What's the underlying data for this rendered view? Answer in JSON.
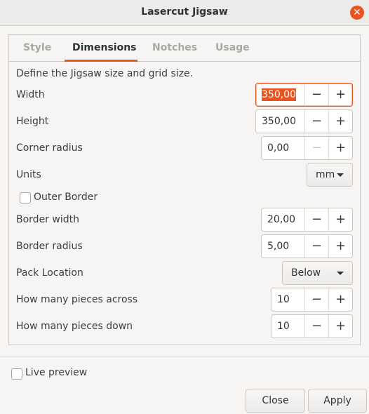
{
  "window": {
    "title": "Lasercut Jigsaw"
  },
  "tabs": [
    {
      "label": "Style",
      "active": false
    },
    {
      "label": "Dimensions",
      "active": true
    },
    {
      "label": "Notches",
      "active": false
    },
    {
      "label": "Usage",
      "active": false
    }
  ],
  "page": {
    "description": "Define the Jigsaw size and grid size.",
    "width": {
      "label": "Width",
      "value": "350,00"
    },
    "height": {
      "label": "Height",
      "value": "350,00"
    },
    "corner_radius": {
      "label": "Corner radius",
      "value": "0,00"
    },
    "units": {
      "label": "Units",
      "selected": "mm"
    },
    "outer_border": {
      "label": "Outer Border",
      "checked": false
    },
    "border_width": {
      "label": "Border width",
      "value": "20,00"
    },
    "border_radius": {
      "label": "Border radius",
      "value": "5,00"
    },
    "pack_location": {
      "label": "Pack Location",
      "selected": "Below"
    },
    "pieces_across": {
      "label": "How many pieces across",
      "value": "10"
    },
    "pieces_down": {
      "label": "How many pieces down",
      "value": "10"
    }
  },
  "spin": {
    "minus": "−",
    "plus": "+"
  },
  "footer": {
    "live_preview": {
      "label": "Live preview",
      "checked": false
    },
    "close_label": "Close",
    "apply_label": "Apply"
  },
  "icons": {
    "close": "close-icon",
    "dropdown": "chevron-down-icon"
  },
  "colors": {
    "accent": "#e95420",
    "background": "#f6f5f4"
  }
}
